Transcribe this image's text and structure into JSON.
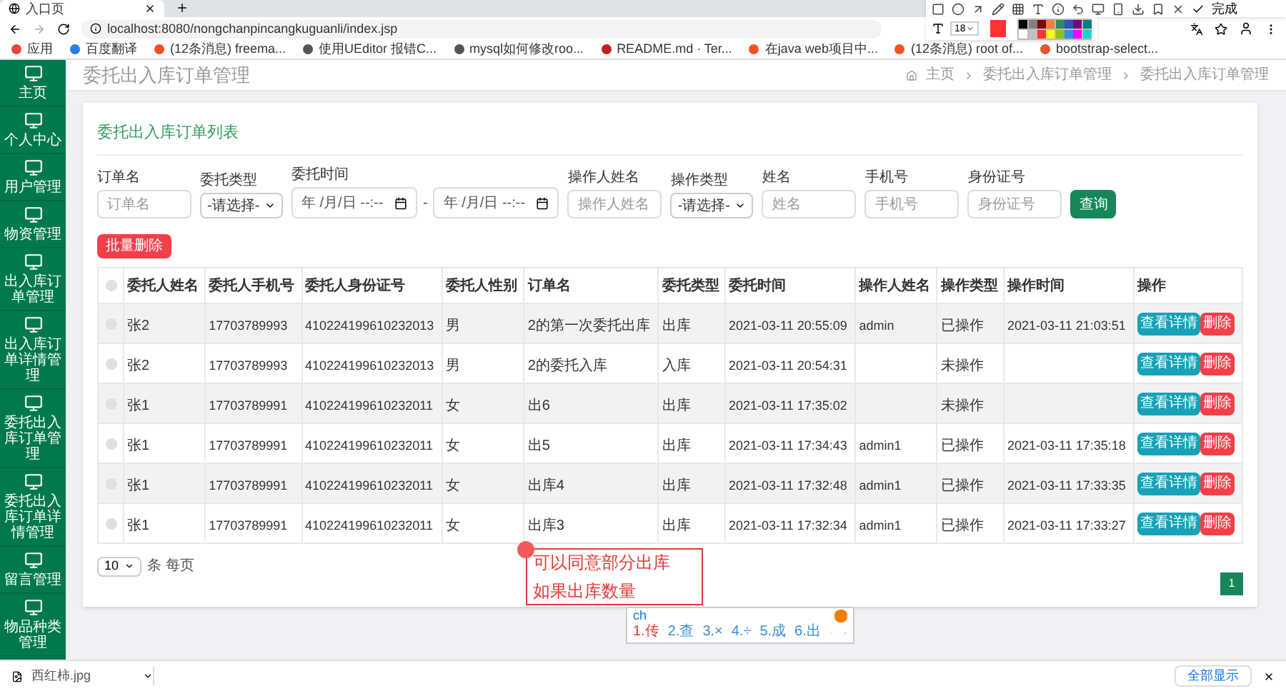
{
  "browser": {
    "tab_title": "入口页",
    "url": "localhost:8080/nongchanpincangkuguanli/index.jsp",
    "bookmarks": [
      {
        "label": "应用",
        "color": "#e8453c"
      },
      {
        "label": "百度翻译",
        "color": "#2b7de9"
      },
      {
        "label": "(12条消息) freema...",
        "color": "#f4511e"
      },
      {
        "label": "使用UEditor 报错C...",
        "color": "#555555"
      },
      {
        "label": "mysql如何修改roo...",
        "color": "#555555"
      },
      {
        "label": "README.md · Ter...",
        "color": "#c71d23"
      },
      {
        "label": "在java web项目中...",
        "color": "#f4511e"
      },
      {
        "label": "(12条消息) root of...",
        "color": "#f4511e"
      },
      {
        "label": "bootstrap-select...",
        "color": "#e4572e"
      }
    ]
  },
  "screenshot_toolbar": {
    "font_size": "18",
    "done_label": "完成",
    "current": {
      "color": "#ff3333"
    },
    "palette": [
      {
        "color": "#000000"
      },
      {
        "color": "#808080"
      },
      {
        "color": "#800000"
      },
      {
        "color": "#f08030"
      },
      {
        "color": "#2e8b57"
      },
      {
        "color": "#3050c0"
      },
      {
        "color": "#800080"
      },
      {
        "color": "#008080"
      },
      {
        "color": "#ffffff"
      },
      {
        "color": "#c0c0c0"
      },
      {
        "color": "#ff3333"
      },
      {
        "color": "#ffff00"
      },
      {
        "color": "#90c020"
      },
      {
        "color": "#3090e0"
      },
      {
        "color": "#ff00ff"
      },
      {
        "color": "#20d0d0"
      }
    ]
  },
  "sidebar": {
    "items": [
      {
        "label": "主页"
      },
      {
        "label": "个人中心"
      },
      {
        "label": "用户管理"
      },
      {
        "label": "物资管理"
      },
      {
        "label": "出入库订单管理"
      },
      {
        "label": "出入库订单详情管理"
      },
      {
        "label": "委托出入库订单管理"
      },
      {
        "label": "委托出入库订单详情管理"
      },
      {
        "label": "留言管理"
      },
      {
        "label": "物品种类管理"
      }
    ]
  },
  "header": {
    "title": "委托出入库订单管理",
    "breadcrumb": [
      "主页",
      "委托出入库订单管理",
      "委托出入库订单管理"
    ]
  },
  "panel_title": "委托出入库订单列表",
  "filters": [
    {
      "kind": "text",
      "label": "订单名",
      "placeholder": "订单名"
    },
    {
      "kind": "select",
      "label": "委托类型",
      "value": "-请选择-"
    },
    {
      "kind": "daterange",
      "label": "委托时间",
      "placeholder": "年 /月/日 --:--",
      "separator": "-",
      "placeholder_end": "年 /月/日 --:--"
    },
    {
      "kind": "text",
      "label": "操作人姓名",
      "placeholder": "操作人姓名"
    },
    {
      "kind": "select",
      "label": "操作类型",
      "value": "-请选择-"
    },
    {
      "kind": "text",
      "label": "姓名",
      "placeholder": "姓名"
    },
    {
      "kind": "text",
      "label": "手机号",
      "placeholder": "手机号"
    },
    {
      "kind": "text",
      "label": "身份证号",
      "placeholder": "身份证号"
    }
  ],
  "search_button": "查询",
  "bulk_delete_button": "批量删除",
  "table": {
    "all_checked": false,
    "columns": [
      "委托人姓名",
      "委托人手机号",
      "委托人身份证号",
      "委托人性别",
      "订单名",
      "委托类型",
      "委托时间",
      "操作人姓名",
      "操作类型",
      "操作时间",
      "操作"
    ],
    "rows": [
      {
        "checked": false,
        "cells": [
          "张2",
          "17703789993",
          "410224199610232013",
          "男",
          "2的第一次委托出库",
          "出库",
          "2021-03-11 20:55:09",
          "admin",
          "已操作",
          "2021-03-11 21:03:51"
        ],
        "actions": [
          "查看详情",
          "删除"
        ]
      },
      {
        "checked": false,
        "cells": [
          "张2",
          "17703789993",
          "410224199610232013",
          "男",
          "2的委托入库",
          "入库",
          "2021-03-11 20:54:31",
          "",
          "未操作",
          ""
        ],
        "actions": [
          "查看详情",
          "删除"
        ]
      },
      {
        "checked": false,
        "cells": [
          "张1",
          "17703789991",
          "410224199610232011",
          "女",
          "出6",
          "出库",
          "2021-03-11 17:35:02",
          "",
          "未操作",
          ""
        ],
        "actions": [
          "查看详情",
          "删除"
        ]
      },
      {
        "checked": false,
        "cells": [
          "张1",
          "17703789991",
          "410224199610232011",
          "女",
          "出5",
          "出库",
          "2021-03-11 17:34:43",
          "admin1",
          "已操作",
          "2021-03-11 17:35:18"
        ],
        "actions": [
          "查看详情",
          "删除"
        ]
      },
      {
        "checked": false,
        "cells": [
          "张1",
          "17703789991",
          "410224199610232011",
          "女",
          "出库4",
          "出库",
          "2021-03-11 17:32:48",
          "admin1",
          "已操作",
          "2021-03-11 17:33:35"
        ],
        "actions": [
          "查看详情",
          "删除"
        ]
      },
      {
        "checked": false,
        "cells": [
          "张1",
          "17703789991",
          "410224199610232011",
          "女",
          "出库3",
          "出库",
          "2021-03-11 17:32:34",
          "admin1",
          "已操作",
          "2021-03-11 17:33:27"
        ],
        "actions": [
          "查看详情",
          "删除"
        ]
      }
    ]
  },
  "pagination": {
    "page_size": "10",
    "per_page_label": "条 每页",
    "pages": [
      {
        "label": "1",
        "selected": true
      }
    ]
  },
  "annotation": {
    "lines": [
      "可以同意部分出库",
      "如果出库数量"
    ]
  },
  "ime": {
    "input": "ch",
    "candidates": [
      {
        "label": "1.传",
        "selected": true
      },
      {
        "label": "2.查",
        "selected": false
      },
      {
        "label": "3.×",
        "selected": false
      },
      {
        "label": "4.÷",
        "selected": false
      },
      {
        "label": "5.成",
        "selected": false
      },
      {
        "label": "6.出",
        "selected": false
      }
    ]
  },
  "download_bar": {
    "file": "西红柿.jpg",
    "show_all": "全部显示"
  }
}
